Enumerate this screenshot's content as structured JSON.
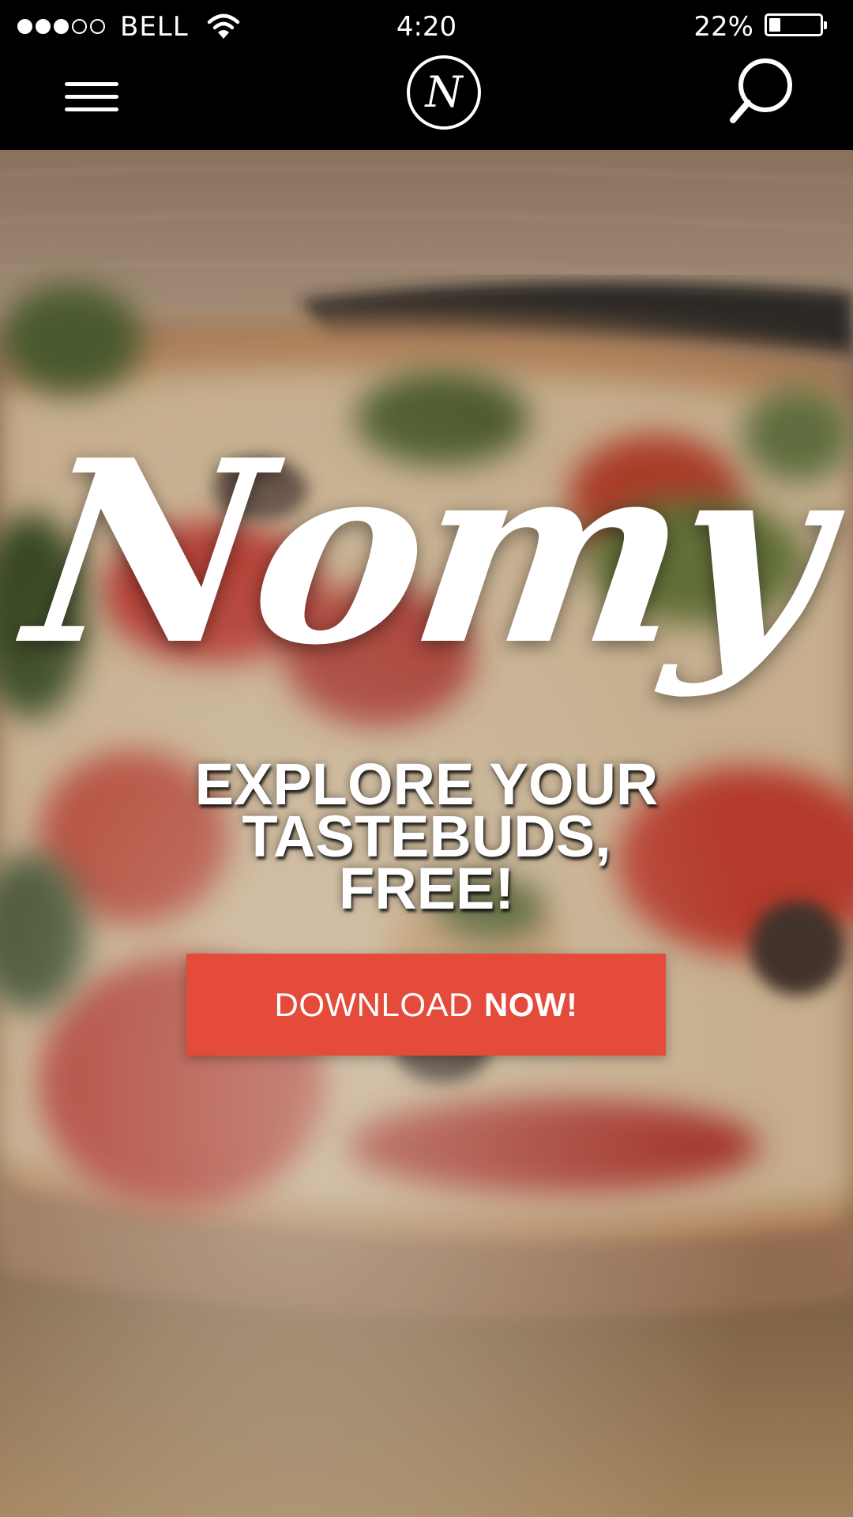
{
  "status_bar": {
    "signal_bars_filled": 3,
    "signal_bars_total": 5,
    "carrier": "BELL",
    "time": "4:20",
    "battery_percent_text": "22%",
    "battery_level": 0.22
  },
  "nav": {
    "menu_icon": "hamburger-menu-icon",
    "logo_letter": "N",
    "search_icon": "magnifier-search-icon"
  },
  "hero": {
    "background": "pizza-photo",
    "brand_name": "Nomy",
    "tagline_lines": [
      "EXPLORE YOUR",
      "TASTEBUDS,",
      "FREE!"
    ],
    "cta": {
      "label_light": "DOWNLOAD",
      "label_bold": "NOW!"
    }
  },
  "colors": {
    "bar_background": "#000000",
    "cta_background": "#e44b3b",
    "text": "#ffffff"
  }
}
